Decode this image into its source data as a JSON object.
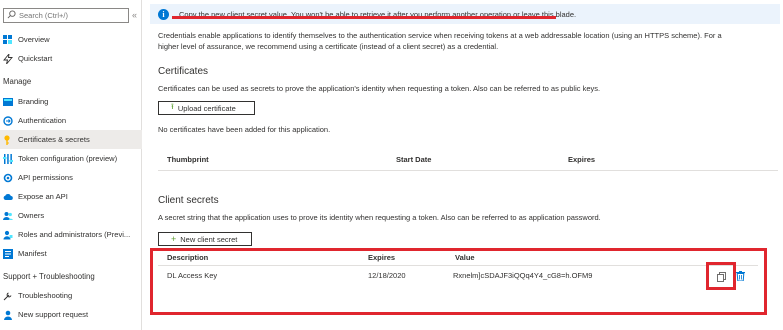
{
  "sidebar": {
    "search_placeholder": "Search (Ctrl+/)",
    "collapse_glyph": "«",
    "top_items": [
      {
        "label": "Overview",
        "icon": "grid-icon"
      },
      {
        "label": "Quickstart",
        "icon": "lightning-icon"
      }
    ],
    "manage_header": "Manage",
    "manage_items": [
      {
        "label": "Branding",
        "icon": "branding-icon"
      },
      {
        "label": "Authentication",
        "icon": "authentication-icon"
      },
      {
        "label": "Certificates & secrets",
        "icon": "key-icon",
        "active": true
      },
      {
        "label": "Token configuration (preview)",
        "icon": "token-icon"
      },
      {
        "label": "API permissions",
        "icon": "api-permissions-icon"
      },
      {
        "label": "Expose an API",
        "icon": "cloud-icon"
      },
      {
        "label": "Owners",
        "icon": "owners-icon"
      },
      {
        "label": "Roles and administrators (Previ...",
        "icon": "roles-icon"
      },
      {
        "label": "Manifest",
        "icon": "manifest-icon"
      }
    ],
    "support_header": "Support + Troubleshooting",
    "support_items": [
      {
        "label": "Troubleshooting",
        "icon": "wrench-icon"
      },
      {
        "label": "New support request",
        "icon": "support-person-icon"
      }
    ]
  },
  "banner": {
    "text": "Copy the new client secret value. You won't be able to retrieve it after you perform another operation or leave this blade."
  },
  "intro": {
    "line1": "Credentials enable applications to identify themselves to the authentication service when receiving tokens at a web addressable location (using an HTTPS scheme). For a",
    "line2": "higher level of assurance, we recommend using a certificate (instead of a client secret) as a credential."
  },
  "certificates": {
    "title": "Certificates",
    "description": "Certificates can be used as secrets to prove the application's identity when requesting a token. Also can be referred to as public keys.",
    "upload_button": "Upload certificate",
    "empty_text": "No certificates have been added for this application.",
    "columns": [
      "Thumbprint",
      "Start Date",
      "Expires"
    ]
  },
  "client_secrets": {
    "title": "Client secrets",
    "description": "A secret string that the application uses to prove its identity when requesting a token. Also can be referred to as application password.",
    "new_button": "New client secret",
    "columns": [
      "Description",
      "Expires",
      "Value"
    ],
    "rows": [
      {
        "description": "DL Access Key",
        "expires": "12/18/2020",
        "value": "Rxnelm]cSDAJF3iQQq4Y4_cG8=h.OFM9"
      }
    ]
  },
  "colors": {
    "highlight_red": "#e0262e",
    "banner_bg": "#ebf3fc",
    "accent_blue": "#0078d4",
    "active_nav_bg": "#edebe9"
  }
}
